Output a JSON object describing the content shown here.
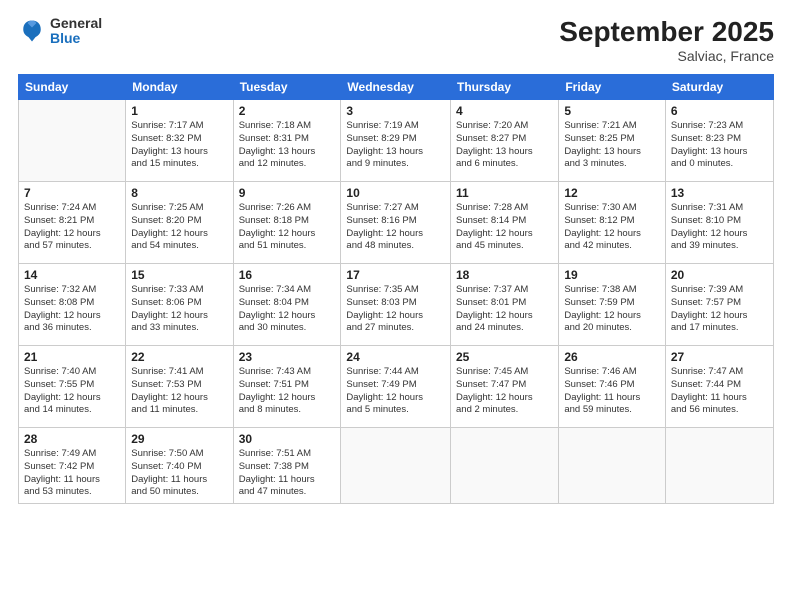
{
  "logo": {
    "general": "General",
    "blue": "Blue"
  },
  "title": "September 2025",
  "subtitle": "Salviac, France",
  "header_days": [
    "Sunday",
    "Monday",
    "Tuesday",
    "Wednesday",
    "Thursday",
    "Friday",
    "Saturday"
  ],
  "weeks": [
    [
      {
        "day": "",
        "info": ""
      },
      {
        "day": "1",
        "info": "Sunrise: 7:17 AM\nSunset: 8:32 PM\nDaylight: 13 hours\nand 15 minutes."
      },
      {
        "day": "2",
        "info": "Sunrise: 7:18 AM\nSunset: 8:31 PM\nDaylight: 13 hours\nand 12 minutes."
      },
      {
        "day": "3",
        "info": "Sunrise: 7:19 AM\nSunset: 8:29 PM\nDaylight: 13 hours\nand 9 minutes."
      },
      {
        "day": "4",
        "info": "Sunrise: 7:20 AM\nSunset: 8:27 PM\nDaylight: 13 hours\nand 6 minutes."
      },
      {
        "day": "5",
        "info": "Sunrise: 7:21 AM\nSunset: 8:25 PM\nDaylight: 13 hours\nand 3 minutes."
      },
      {
        "day": "6",
        "info": "Sunrise: 7:23 AM\nSunset: 8:23 PM\nDaylight: 13 hours\nand 0 minutes."
      }
    ],
    [
      {
        "day": "7",
        "info": "Sunrise: 7:24 AM\nSunset: 8:21 PM\nDaylight: 12 hours\nand 57 minutes."
      },
      {
        "day": "8",
        "info": "Sunrise: 7:25 AM\nSunset: 8:20 PM\nDaylight: 12 hours\nand 54 minutes."
      },
      {
        "day": "9",
        "info": "Sunrise: 7:26 AM\nSunset: 8:18 PM\nDaylight: 12 hours\nand 51 minutes."
      },
      {
        "day": "10",
        "info": "Sunrise: 7:27 AM\nSunset: 8:16 PM\nDaylight: 12 hours\nand 48 minutes."
      },
      {
        "day": "11",
        "info": "Sunrise: 7:28 AM\nSunset: 8:14 PM\nDaylight: 12 hours\nand 45 minutes."
      },
      {
        "day": "12",
        "info": "Sunrise: 7:30 AM\nSunset: 8:12 PM\nDaylight: 12 hours\nand 42 minutes."
      },
      {
        "day": "13",
        "info": "Sunrise: 7:31 AM\nSunset: 8:10 PM\nDaylight: 12 hours\nand 39 minutes."
      }
    ],
    [
      {
        "day": "14",
        "info": "Sunrise: 7:32 AM\nSunset: 8:08 PM\nDaylight: 12 hours\nand 36 minutes."
      },
      {
        "day": "15",
        "info": "Sunrise: 7:33 AM\nSunset: 8:06 PM\nDaylight: 12 hours\nand 33 minutes."
      },
      {
        "day": "16",
        "info": "Sunrise: 7:34 AM\nSunset: 8:04 PM\nDaylight: 12 hours\nand 30 minutes."
      },
      {
        "day": "17",
        "info": "Sunrise: 7:35 AM\nSunset: 8:03 PM\nDaylight: 12 hours\nand 27 minutes."
      },
      {
        "day": "18",
        "info": "Sunrise: 7:37 AM\nSunset: 8:01 PM\nDaylight: 12 hours\nand 24 minutes."
      },
      {
        "day": "19",
        "info": "Sunrise: 7:38 AM\nSunset: 7:59 PM\nDaylight: 12 hours\nand 20 minutes."
      },
      {
        "day": "20",
        "info": "Sunrise: 7:39 AM\nSunset: 7:57 PM\nDaylight: 12 hours\nand 17 minutes."
      }
    ],
    [
      {
        "day": "21",
        "info": "Sunrise: 7:40 AM\nSunset: 7:55 PM\nDaylight: 12 hours\nand 14 minutes."
      },
      {
        "day": "22",
        "info": "Sunrise: 7:41 AM\nSunset: 7:53 PM\nDaylight: 12 hours\nand 11 minutes."
      },
      {
        "day": "23",
        "info": "Sunrise: 7:43 AM\nSunset: 7:51 PM\nDaylight: 12 hours\nand 8 minutes."
      },
      {
        "day": "24",
        "info": "Sunrise: 7:44 AM\nSunset: 7:49 PM\nDaylight: 12 hours\nand 5 minutes."
      },
      {
        "day": "25",
        "info": "Sunrise: 7:45 AM\nSunset: 7:47 PM\nDaylight: 12 hours\nand 2 minutes."
      },
      {
        "day": "26",
        "info": "Sunrise: 7:46 AM\nSunset: 7:46 PM\nDaylight: 11 hours\nand 59 minutes."
      },
      {
        "day": "27",
        "info": "Sunrise: 7:47 AM\nSunset: 7:44 PM\nDaylight: 11 hours\nand 56 minutes."
      }
    ],
    [
      {
        "day": "28",
        "info": "Sunrise: 7:49 AM\nSunset: 7:42 PM\nDaylight: 11 hours\nand 53 minutes."
      },
      {
        "day": "29",
        "info": "Sunrise: 7:50 AM\nSunset: 7:40 PM\nDaylight: 11 hours\nand 50 minutes."
      },
      {
        "day": "30",
        "info": "Sunrise: 7:51 AM\nSunset: 7:38 PM\nDaylight: 11 hours\nand 47 minutes."
      },
      {
        "day": "",
        "info": ""
      },
      {
        "day": "",
        "info": ""
      },
      {
        "day": "",
        "info": ""
      },
      {
        "day": "",
        "info": ""
      }
    ]
  ]
}
